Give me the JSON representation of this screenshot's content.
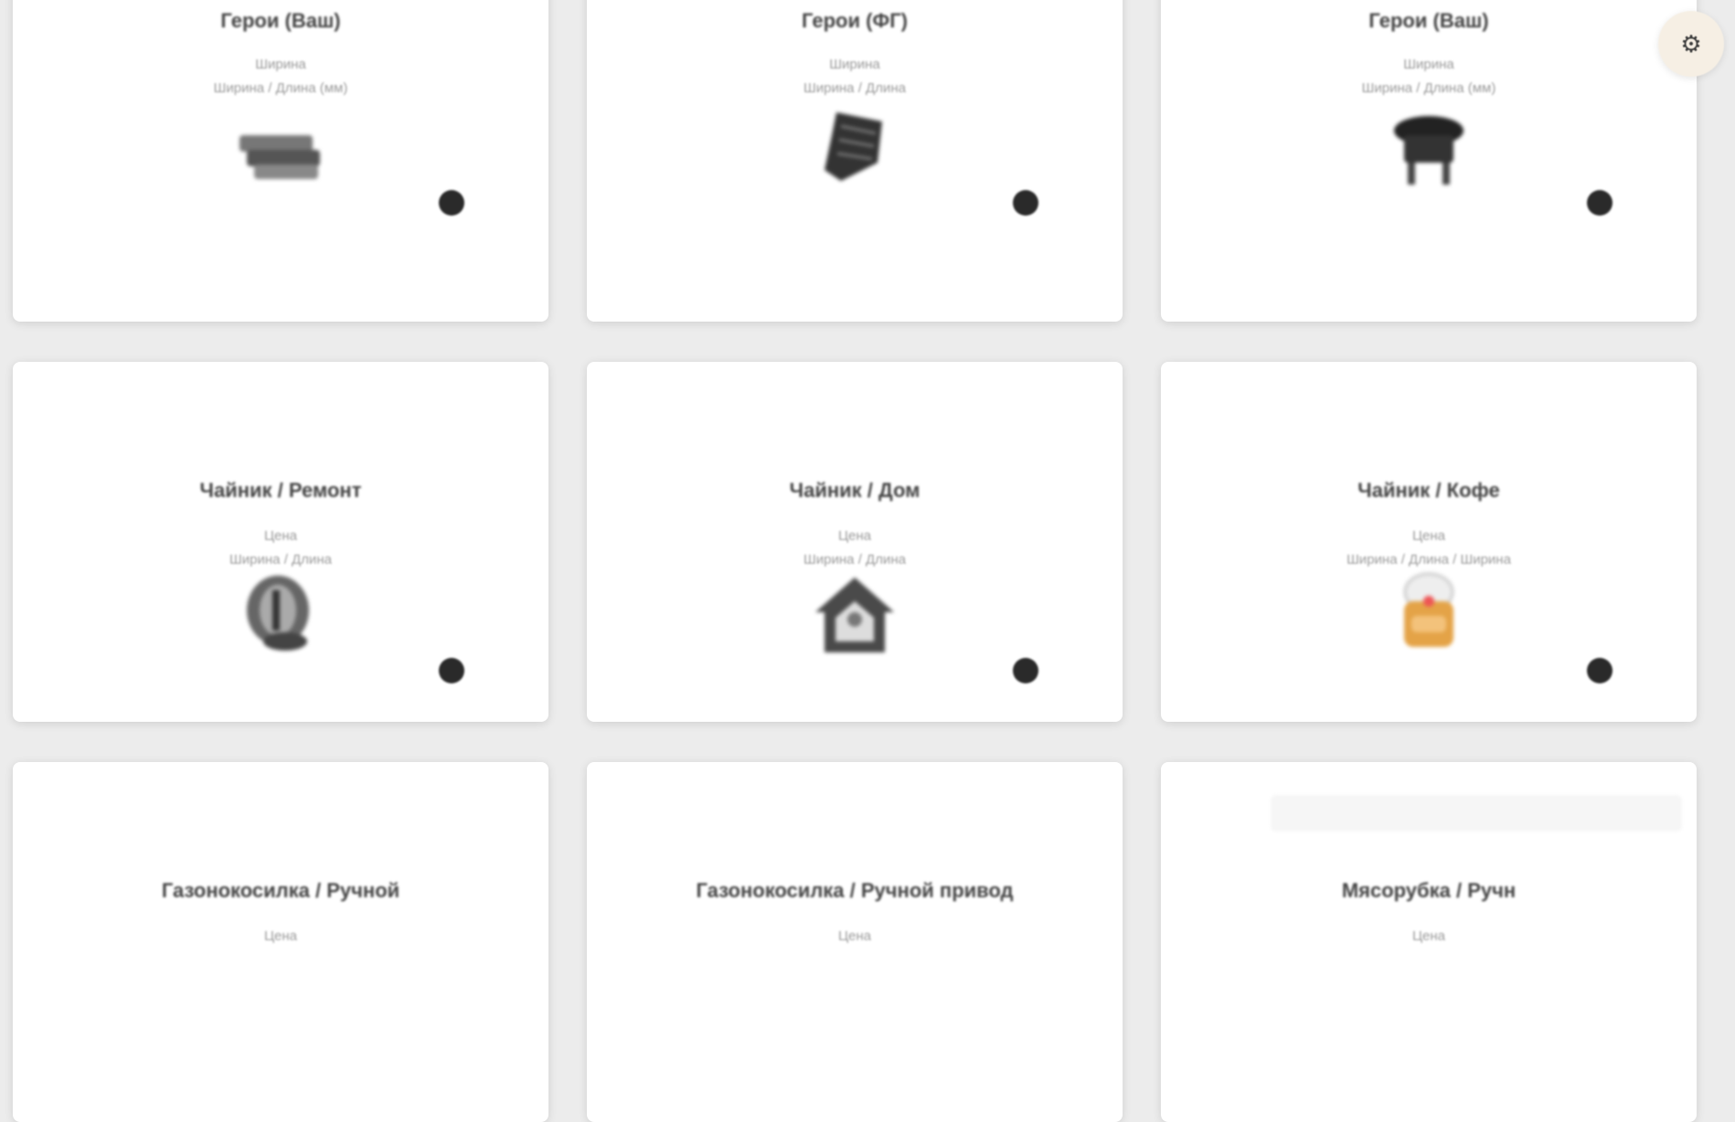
{
  "fab": {
    "icon": "settings-gear-icon"
  },
  "cards": [
    {
      "title": "Герои (Ваш)",
      "line1": "Ширина",
      "line2": "Ширина / Длина (мм)",
      "icon": "stack-icon"
    },
    {
      "title": "Герои (ФГ)",
      "line1": "Ширина",
      "line2": "Ширина / Длина",
      "icon": "seat-icon"
    },
    {
      "title": "Герои (Ваш)",
      "line1": "Ширина",
      "line2": "Ширина / Длина (мм)",
      "icon": "grill-icon"
    },
    {
      "title": "Чайник / Ремонт",
      "line1": "Цена",
      "line2": "Ширина / Длина",
      "icon": "kettle-icon"
    },
    {
      "title": "Чайник / Дом",
      "line1": "Цена",
      "line2": "Ширина / Длина",
      "icon": "house-icon"
    },
    {
      "title": "Чайник / Кофе",
      "line1": "Цена",
      "line2": "Ширина / Длина / Ширина",
      "icon": "cup-icon"
    },
    {
      "title": "Газонокосилка / Ручной",
      "line1": "Цена",
      "line2": "",
      "icon": ""
    },
    {
      "title": "Газонокосилка / Ручной привод",
      "line1": "Цена",
      "line2": "",
      "icon": ""
    },
    {
      "title": "Мясорубка / Ручн",
      "line1": "Цена",
      "line2": "",
      "icon": ""
    }
  ],
  "colors": {
    "page_bg": "#ececec",
    "card_bg": "#ffffff",
    "dot": "#2a2a2a",
    "fab_bg": "#f6efe4"
  }
}
